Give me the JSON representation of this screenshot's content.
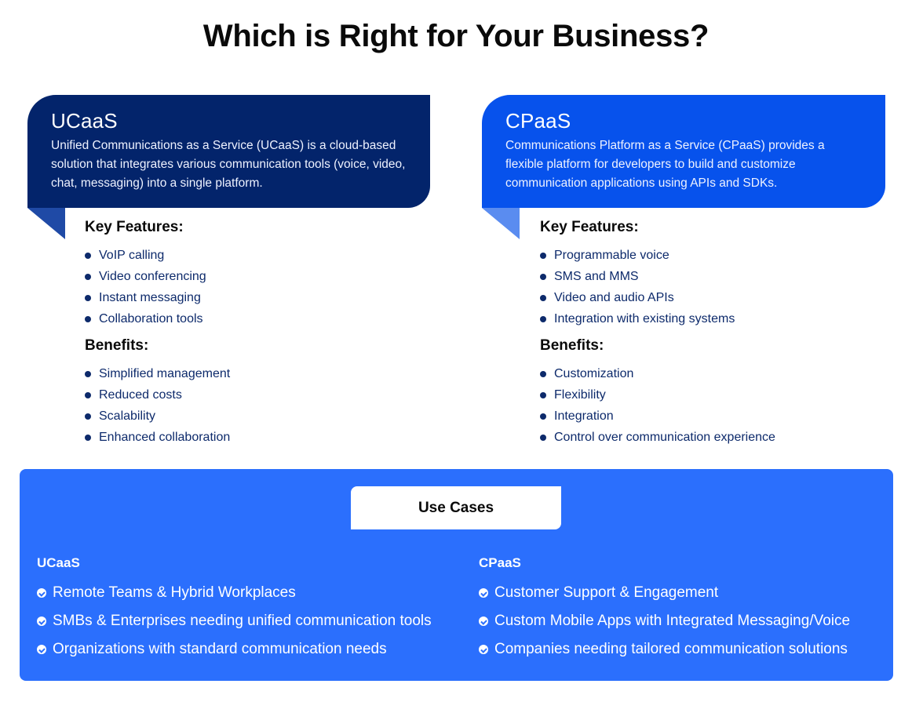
{
  "title": "Which is Right for Your Business?",
  "colors": {
    "ucaas_header": "#03246b",
    "cpaas_header": "#0752ec",
    "usecases_bg": "#2b6ffd",
    "list_text": "#0d2a6b"
  },
  "ucaas": {
    "heading": "UCaaS",
    "description": "Unified Communications as a Service (UCaaS) is a cloud-based solution that integrates various communication tools (voice, video, chat, messaging) into a single platform.",
    "key_features_label": "Key Features:",
    "key_features": [
      "VoIP calling",
      "Video conferencing",
      "Instant messaging",
      "Collaboration tools"
    ],
    "benefits_label": "Benefits:",
    "benefits": [
      "Simplified management",
      "Reduced costs",
      "Scalability",
      "Enhanced collaboration"
    ]
  },
  "cpaas": {
    "heading": "CPaaS",
    "description": "Communications Platform as a Service (CPaaS) provides a flexible platform for developers to build and customize communication applications using APIs and SDKs.",
    "key_features_label": "Key Features:",
    "key_features": [
      "Programmable voice",
      "SMS and MMS",
      "Video and audio APIs",
      "Integration with existing systems"
    ],
    "benefits_label": "Benefits:",
    "benefits": [
      "Customization",
      "Flexibility",
      "Integration",
      "Control over communication experience"
    ]
  },
  "use_cases": {
    "label": "Use Cases",
    "ucaas": {
      "heading": "UCaaS",
      "items": [
        "Remote Teams & Hybrid Workplaces",
        "SMBs & Enterprises needing unified communication tools",
        "Organizations with standard communication needs"
      ]
    },
    "cpaas": {
      "heading": "CPaaS",
      "items": [
        "Customer Support & Engagement",
        "Custom Mobile Apps with Integrated Messaging/Voice",
        "Companies needing tailored communication solutions"
      ]
    }
  }
}
